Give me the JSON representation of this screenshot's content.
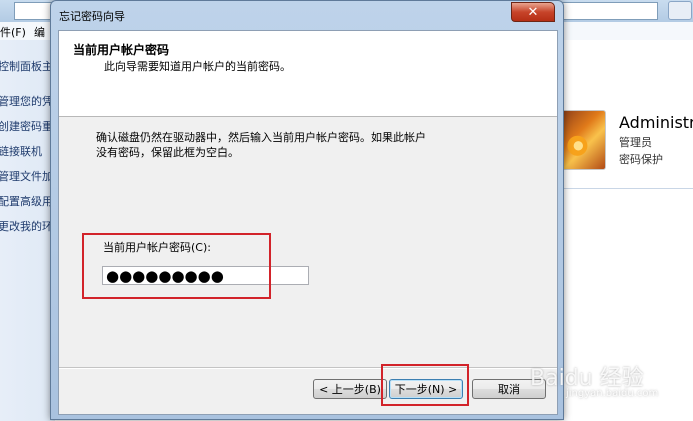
{
  "background_window": {
    "menu": [
      "件(F)",
      "编"
    ],
    "sidebar_links": [
      "控制面板主",
      "管理您的凭",
      "创建密码重",
      "链接联机",
      "管理文件加",
      "配置高级用",
      "更改我的环"
    ],
    "account": {
      "name": "Administr",
      "role": "管理员",
      "status": "密码保护"
    }
  },
  "dialog": {
    "title": "忘记密码向导",
    "close_symbol": "✕",
    "header_title": "当前用户帐户密码",
    "header_subtitle": "此向导需要知道用户帐户的当前密码。",
    "description_line1": "确认磁盘仍然在驱动器中，然后输入当前用户帐户密码。如果此帐户",
    "description_line2": "没有密码，保留此框为空白。",
    "password_label": "当前用户帐户密码(C):",
    "password_value": "●●●●●●●●●",
    "buttons": {
      "back": "< 上一步(B)",
      "next": "下一步(N) >",
      "cancel": "取消"
    }
  },
  "watermark": {
    "text": "Baidu 经验",
    "sub": "jingyan.baidu.com"
  },
  "colors": {
    "highlight": "#d2232a",
    "title_bar": "#b3cbe4"
  }
}
